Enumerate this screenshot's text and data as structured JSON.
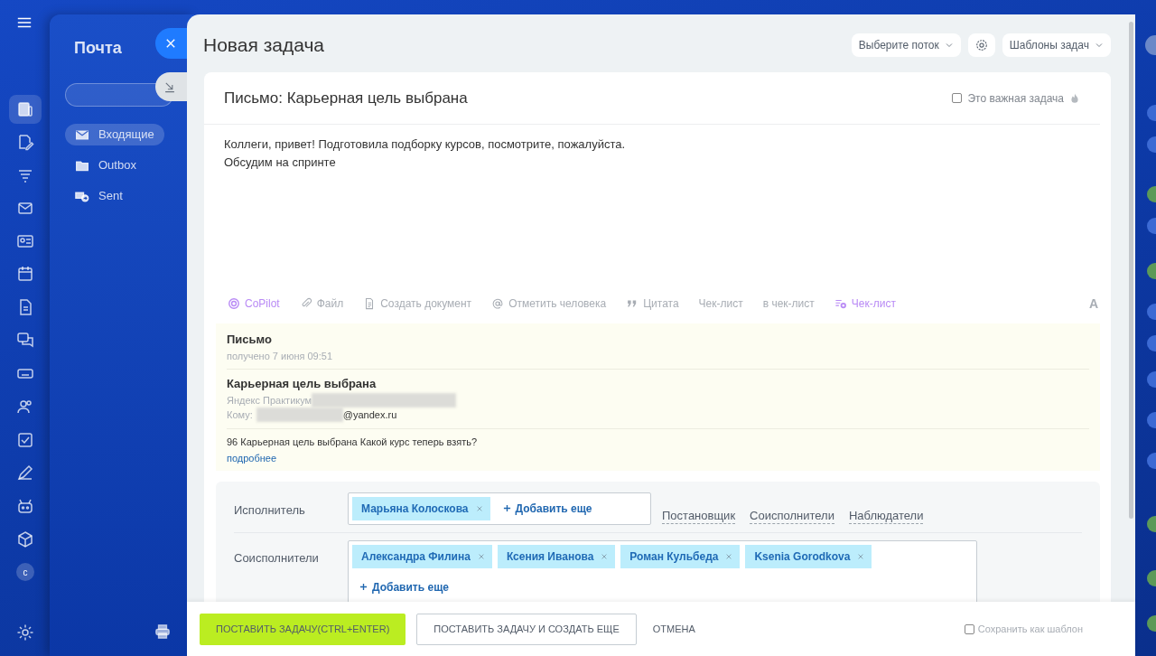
{
  "app_nav": {
    "items": [
      {
        "kind": "news",
        "selected": true
      },
      {
        "kind": "edit-doc",
        "selected": false
      },
      {
        "kind": "filter",
        "selected": false
      },
      {
        "kind": "mail",
        "selected": false
      },
      {
        "kind": "card",
        "selected": false
      },
      {
        "kind": "calendar",
        "selected": false
      },
      {
        "kind": "doc",
        "selected": false
      },
      {
        "kind": "chat",
        "selected": false
      },
      {
        "kind": "drive",
        "selected": false
      },
      {
        "kind": "people",
        "selected": false
      },
      {
        "kind": "check",
        "selected": false
      },
      {
        "kind": "pen",
        "selected": false
      },
      {
        "kind": "robot",
        "selected": false
      },
      {
        "kind": "box",
        "selected": false
      },
      {
        "kind": "avatar",
        "badge": "c",
        "selected": false
      },
      {
        "kind": "gear",
        "selected": false
      }
    ]
  },
  "mail": {
    "title": "Почта",
    "folders": [
      {
        "label": "Входящие",
        "kind": "inbox",
        "selected": true
      },
      {
        "label": "Outbox",
        "kind": "folder",
        "selected": false
      },
      {
        "label": "Sent",
        "kind": "sent",
        "selected": false
      }
    ]
  },
  "task": {
    "title": "Новая задача",
    "flow_select": "Выберите поток",
    "templates_select": "Шаблоны задач",
    "subject": "Письмо: Карьерная цель выбрана",
    "important": {
      "label": "Это важная задача",
      "checked": false
    },
    "body": [
      "Коллеги, привет! Подготовила подборку курсов, посмотрите, пожалуйста.",
      "Обсудим на спринте"
    ],
    "toolbar": [
      {
        "label": "CoPilot",
        "kind": "copilot"
      },
      {
        "label": "Файл",
        "kind": "file"
      },
      {
        "label": "Создать документ",
        "kind": "document"
      },
      {
        "label": "Отметить человека",
        "kind": "mention"
      },
      {
        "label": "Цитата",
        "kind": "quote"
      },
      {
        "label": "Чек-лист",
        "kind": "text"
      },
      {
        "label": "в чек-лист",
        "kind": "text"
      },
      {
        "label": "Чек-лист",
        "kind": "checklist"
      }
    ],
    "font_button": "A",
    "email": {
      "heading": "Письмо",
      "received": "получено 7 июня 09:51",
      "subject": "Карьерная цель выбрана",
      "from": "Яндекс Практикум",
      "to_label": "Кому:",
      "to_domain": "@yandex.ru",
      "preview": "96 Карьерная цель выбрана Какой курс теперь взять?",
      "more": "подробнее"
    },
    "people": [
      {
        "label": "Исполнитель",
        "members": [
          "Марьяна Колоскова"
        ],
        "add": "Добавить еще",
        "roles": [
          "Постановщик",
          "Соисполнители",
          "Наблюдатели"
        ]
      },
      {
        "label": "Соисполнители",
        "members": [
          "Александра Филина",
          "Ксения Иванова",
          "Роман Кульбеда",
          "Ksenia Gorodkova"
        ],
        "add": "Добавить еще"
      }
    ]
  },
  "footer": {
    "submit": "ПОСТАВИТЬ ЗАДАЧУ(CTRL+ENTER)",
    "submit_more": "ПОСТАВИТЬ ЗАДАЧУ И СОЗДАТЬ ЕЩЕ",
    "cancel": "ОТМЕНА",
    "save_template": {
      "label": "Сохранить как шаблон",
      "checked": false
    }
  }
}
